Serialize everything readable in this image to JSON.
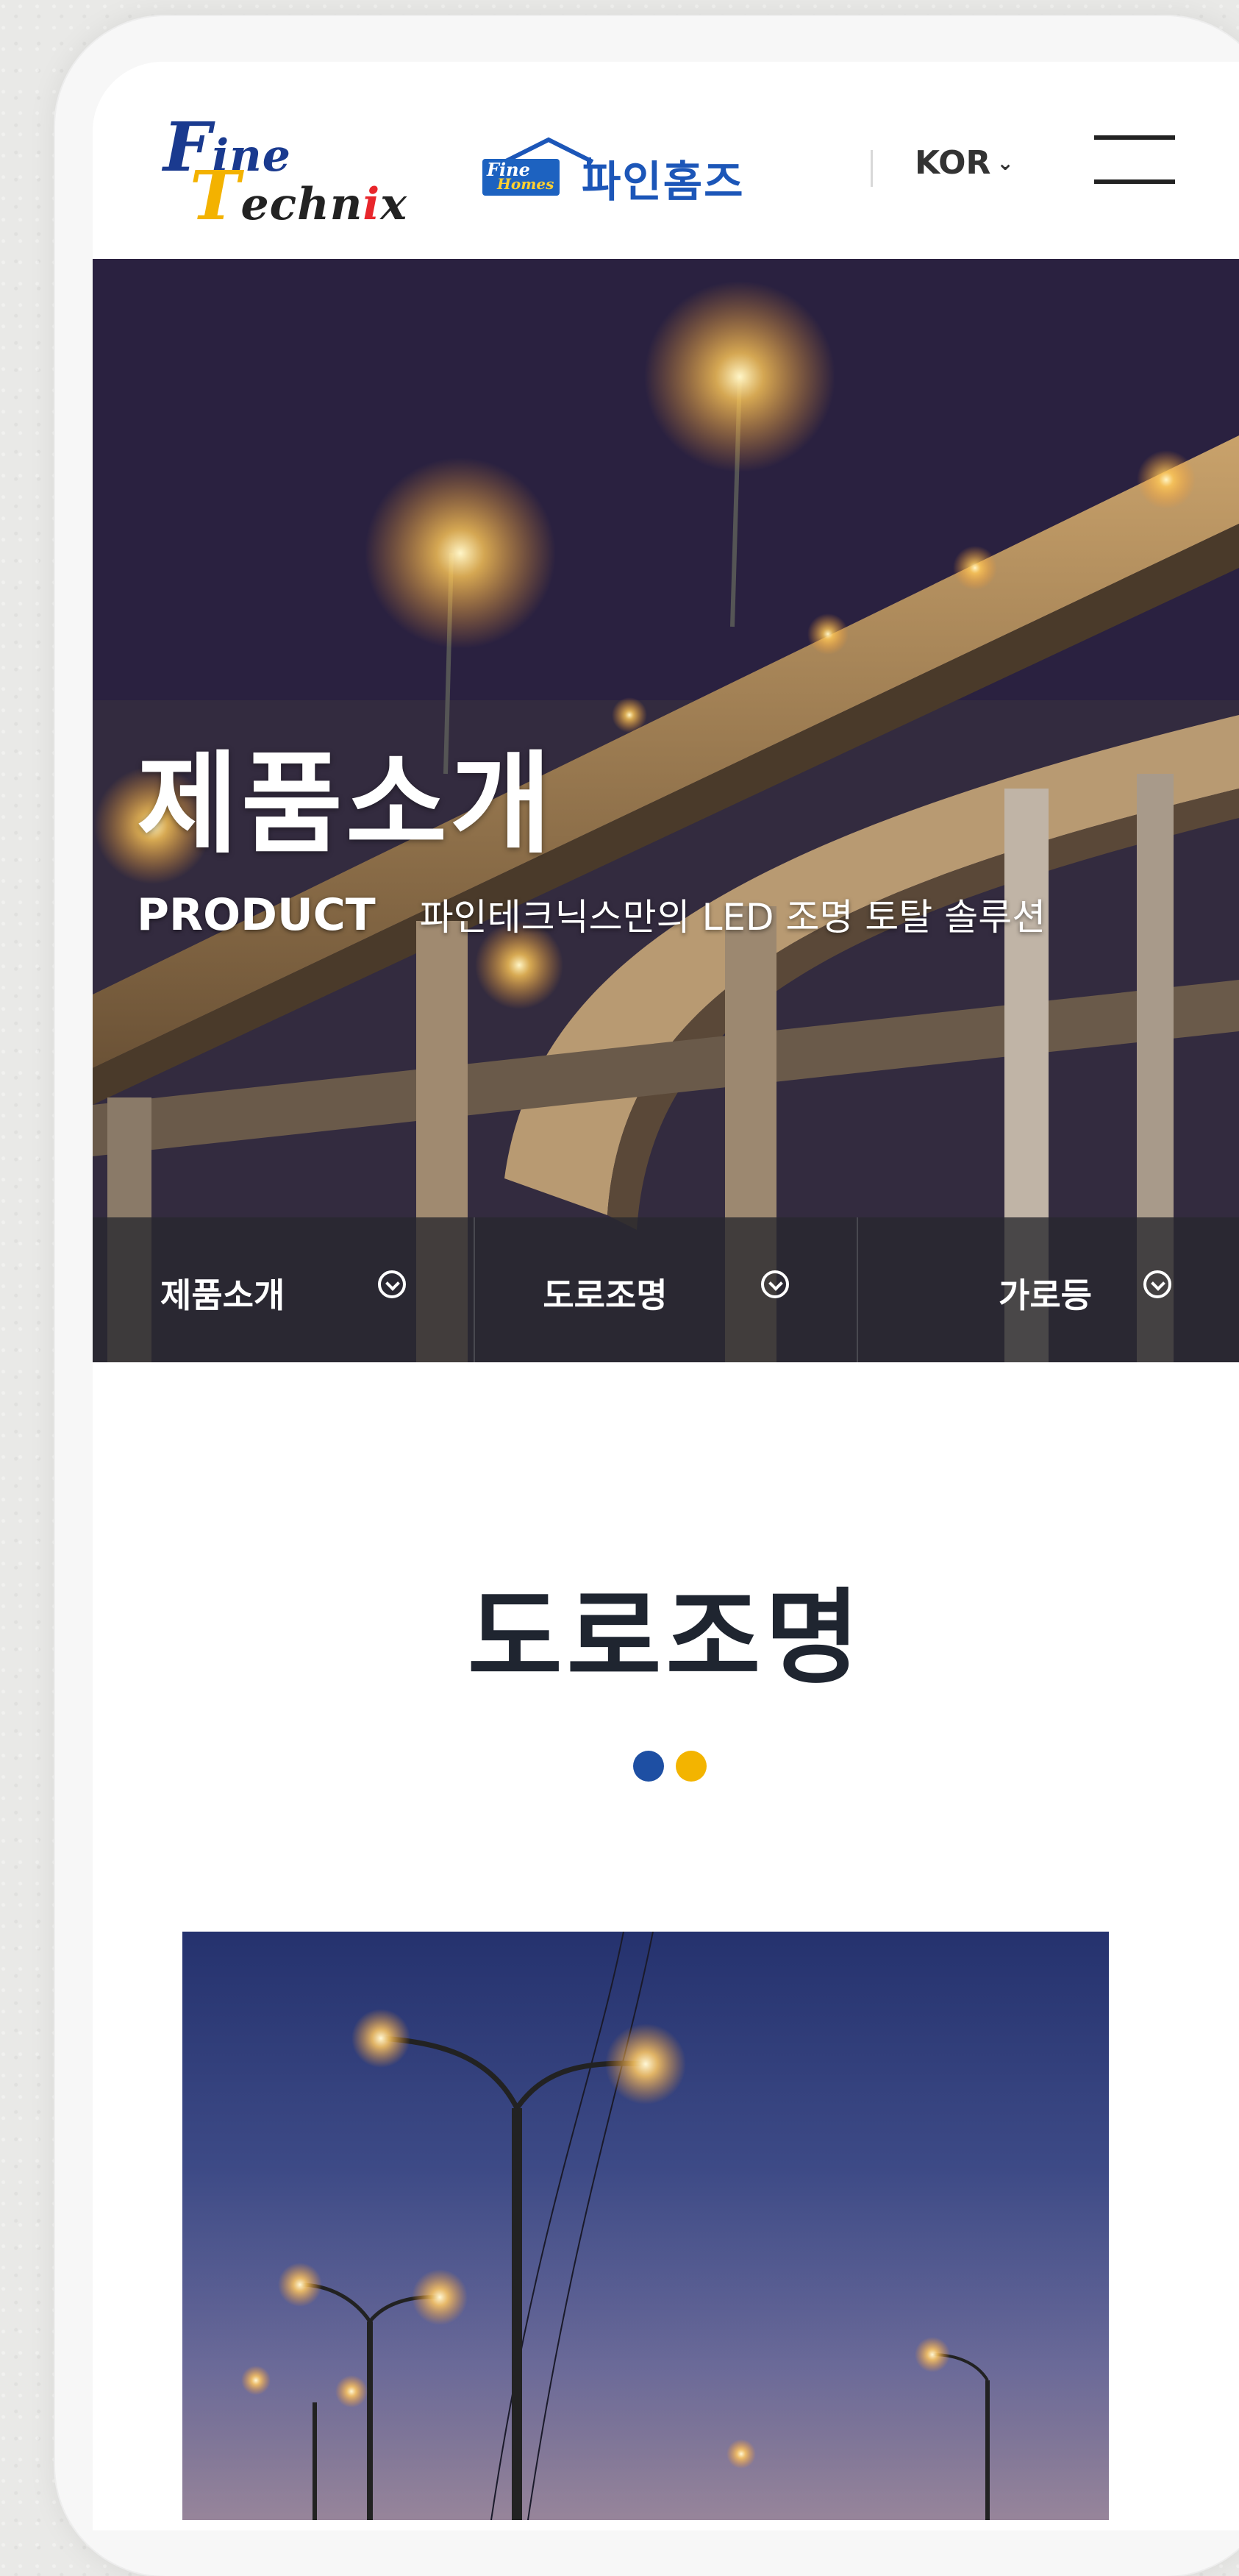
{
  "header": {
    "logo_line1_cap": "F",
    "logo_line1_rest": "ine",
    "logo_line2_cap": "T",
    "logo_line2_rest_a": "echn",
    "logo_line2_rest_b": "i",
    "logo_line2_rest_c": "x",
    "homes_badge_fine": "Fine",
    "homes_badge_homes": "Homes",
    "homes_text": "파인홈즈",
    "language": "KOR",
    "menu_icon": "hamburger-icon"
  },
  "hero": {
    "title": "제품소개",
    "sub_en": "PRODUCT",
    "sub_ko": "파인테크닉스만의 LED 조명 토탈 솔루션",
    "subnav": [
      {
        "label": "제품소개",
        "icon": "chevron-down-circle-icon"
      },
      {
        "label": "도로조명",
        "icon": "chevron-down-circle-icon"
      },
      {
        "label": "가로등",
        "icon": "chevron-down-circle-icon"
      }
    ]
  },
  "section": {
    "title": "도로조명",
    "dots": [
      "#1e4fa3",
      "#f3b400"
    ]
  },
  "colors": {
    "brand_blue": "#1a3a8f",
    "brand_yellow": "#f3b200",
    "homes_blue": "#1c56b8"
  }
}
